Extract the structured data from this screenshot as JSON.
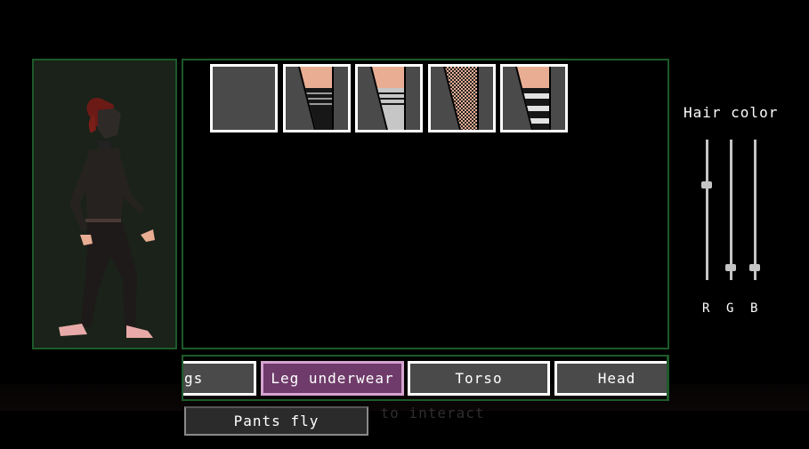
{
  "hint_text": "(E) to interact",
  "preview": {
    "label": "character preview"
  },
  "items": [
    {
      "name": "none",
      "skin": false,
      "sock": "none"
    },
    {
      "name": "black-striped-sock",
      "skin": true,
      "sock": "#171717",
      "stripe": "#9a9a9a"
    },
    {
      "name": "white-striped-sock",
      "skin": true,
      "sock": "#c6c6c6",
      "stripe": "#171717"
    },
    {
      "name": "fishnet",
      "skin": true,
      "sock": "fishnet"
    },
    {
      "name": "black-white-striped-sock",
      "skin": true,
      "sock": "bw"
    }
  ],
  "tabs": [
    {
      "label": "gs",
      "selected": false
    },
    {
      "label": "Leg underwear",
      "selected": true
    },
    {
      "label": "Torso",
      "selected": false
    },
    {
      "label": "Head",
      "selected": false
    }
  ],
  "dropdown": {
    "label": "Pants fly"
  },
  "hair_color": {
    "title": "Hair color",
    "sliders": [
      {
        "label": "R",
        "value": 0.68
      },
      {
        "label": "G",
        "value": 0.09
      },
      {
        "label": "B",
        "value": 0.09
      }
    ]
  },
  "colors": {
    "panel_border": "#1d5a2a",
    "selected_tab": "#6e3b6a",
    "skin": "#e8ad93"
  }
}
